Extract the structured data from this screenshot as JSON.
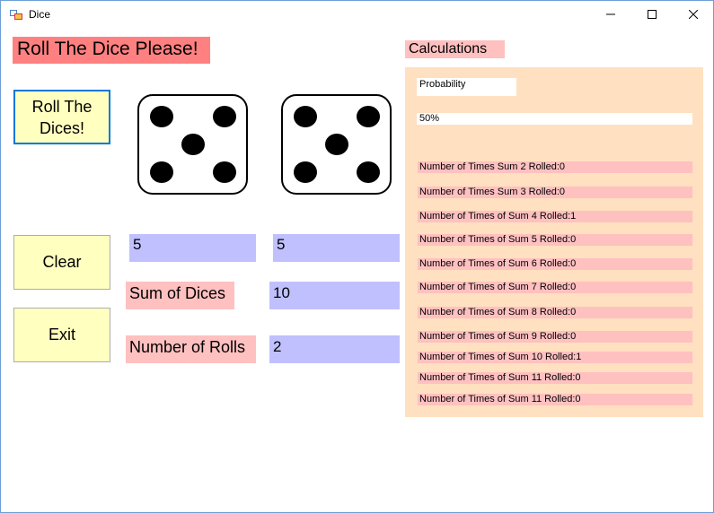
{
  "window": {
    "title": "Dice",
    "controls": {
      "minimize": "minimize-icon",
      "maximize": "maximize-icon",
      "close": "close-icon"
    }
  },
  "header": {
    "title": "Roll The Dice Please!"
  },
  "buttons": {
    "roll": "Roll The Dices!",
    "clear": "Clear",
    "exit": "Exit"
  },
  "dice": {
    "die1": 5,
    "die2": 5
  },
  "results": {
    "die1_value": "5",
    "die2_value": "5",
    "sum_label": "Sum of Dices",
    "sum_value": "10",
    "rolls_label": "Number of Rolls",
    "rolls_value": "2"
  },
  "calculations": {
    "title": "Calculations",
    "probability_label": "Probability",
    "probability_value": "50%",
    "rows": [
      "Number of Times Sum 2 Rolled:0",
      "Number of Times Sum 3 Rolled:0",
      "Number of Times of Sum 4 Rolled:1",
      "Number of Times of Sum 5 Rolled:0",
      "Number of Times of Sum 6 Rolled:0",
      "Number of Times of Sum 7 Rolled:0",
      "Number of Times of Sum 8 Rolled:0",
      "Number of Times of Sum 9 Rolled:0",
      "Number of Times of Sum 10 Rolled:1",
      "Number of Times of Sum 11 Rolled:0",
      "Number of Times of Sum 11 Rolled:0"
    ]
  },
  "colors": {
    "banner": "#ff8080",
    "label": "#ffc0c0",
    "value_box": "#c0c0ff",
    "button": "#ffffc0",
    "panel": "#ffe0c0",
    "focus": "#0078d7"
  }
}
